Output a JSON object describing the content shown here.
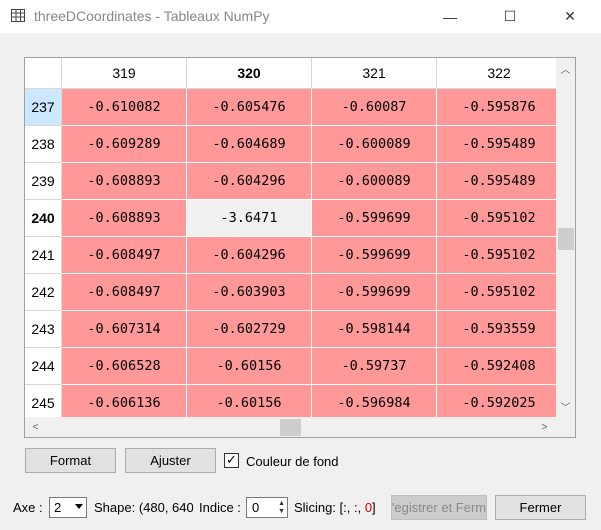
{
  "window": {
    "title": "threeDCoordinates - Tableaux NumPy",
    "min_glyph": "—",
    "max_glyph": "☐",
    "close_glyph": "✕"
  },
  "table": {
    "columns": [
      {
        "label": "319",
        "bold": false
      },
      {
        "label": "320",
        "bold": true
      },
      {
        "label": "321",
        "bold": false
      },
      {
        "label": "322",
        "bold": false
      }
    ],
    "rows": [
      {
        "label": "237",
        "highlight": true,
        "bold": false,
        "cells": [
          "-0.610082",
          "-0.605476",
          "-0.60087",
          "-0.595876"
        ]
      },
      {
        "label": "238",
        "highlight": false,
        "bold": false,
        "cells": [
          "-0.609289",
          "-0.604689",
          "-0.600089",
          "-0.595489"
        ]
      },
      {
        "label": "239",
        "highlight": false,
        "bold": false,
        "cells": [
          "-0.608893",
          "-0.604296",
          "-0.600089",
          "-0.595489"
        ]
      },
      {
        "label": "240",
        "highlight": false,
        "bold": true,
        "cells": [
          "-0.608893",
          "-3.6471",
          "-0.599699",
          "-0.595102"
        ]
      },
      {
        "label": "241",
        "highlight": false,
        "bold": false,
        "cells": [
          "-0.608497",
          "-0.604296",
          "-0.599699",
          "-0.595102"
        ]
      },
      {
        "label": "242",
        "highlight": false,
        "bold": false,
        "cells": [
          "-0.608497",
          "-0.603903",
          "-0.599699",
          "-0.595102"
        ]
      },
      {
        "label": "243",
        "highlight": false,
        "bold": false,
        "cells": [
          "-0.607314",
          "-0.602729",
          "-0.598144",
          "-0.593559"
        ]
      },
      {
        "label": "244",
        "highlight": false,
        "bold": false,
        "cells": [
          "-0.606528",
          "-0.60156",
          "-0.59737",
          "-0.592408"
        ]
      },
      {
        "label": "245",
        "highlight": false,
        "bold": false,
        "cells": [
          "-0.606136",
          "-0.60156",
          "-0.596984",
          "-0.592025"
        ]
      }
    ],
    "special_cell": {
      "row": 3,
      "col": 1
    },
    "colors": {
      "cell_bg": "#ff9999",
      "special_bg": "#f0f0f0",
      "row_highlight": "#cce8ff"
    }
  },
  "scrollbars": {
    "up": "︿",
    "down": "﹀",
    "left": "<",
    "right": ">"
  },
  "controls": {
    "format_label": "Format",
    "resize_label": "Ajuster",
    "bgcolor_label": "Couleur de fond",
    "bgcolor_checked": true,
    "check_glyph": "✓"
  },
  "bottom": {
    "axis_label": "Axe :",
    "axis_value": "2",
    "shape_text": "Shape: (480, 640",
    "index_label": "Indice :",
    "index_value": "0",
    "slicing_label": "Slicing: [:, :, ",
    "slicing_value": "0",
    "slicing_end": "]",
    "save_close_label": "'egistrer et Ferm",
    "close_label": "Fermer",
    "slicing_value_color": "#cc0000"
  }
}
